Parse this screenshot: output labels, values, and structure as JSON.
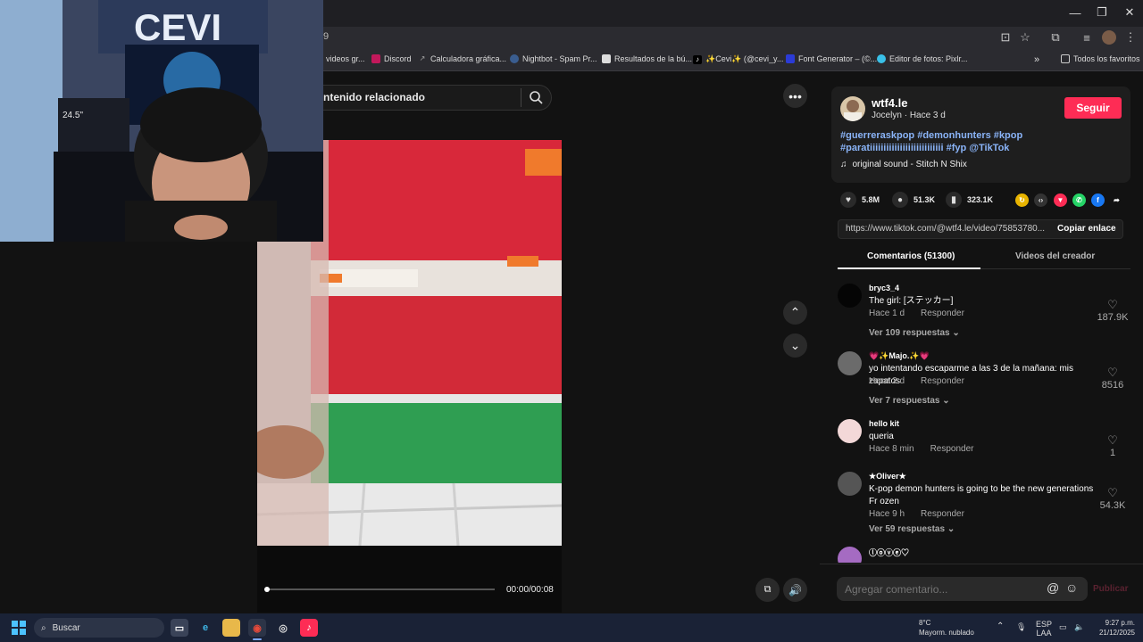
{
  "browser": {
    "address_fragment": "9",
    "bookmarks": [
      {
        "label": "videos gr..."
      },
      {
        "label": "Discord"
      },
      {
        "label": "Calculadora gráfica..."
      },
      {
        "label": "Nightbot - Spam Pr..."
      },
      {
        "label": "Resultados de la bú..."
      },
      {
        "label": "✨Cevi✨ (@cevi_y..."
      },
      {
        "label": "Font Generator – (©..."
      },
      {
        "label": "Editor de fotos: Pixlr..."
      }
    ],
    "all_favorites": "Todos los favoritos"
  },
  "webcam": {
    "banner_text": "CEVI",
    "monitor_text": "24.5\""
  },
  "search": {
    "text": "ntenido relacionado"
  },
  "video": {
    "timecode": "00:00/00:08",
    "progress": 0.0
  },
  "post": {
    "username": "wtf4.le",
    "display_name": "Jocelyn",
    "separator": "·",
    "posted": "Hace 3 d",
    "follow_label": "Seguir",
    "hashtags_line1": "#guerreraskpop #demonhunters #kpop",
    "hashtags_line2": "#paratiiiiiiiiiiiiiiiiiiiiiiiiiii #fyp @TikTok",
    "sound": "original sound - Stitch N Shix",
    "likes": "5.8M",
    "comments": "51.3K",
    "saves": "323.1K",
    "link": "https://www.tiktok.com/@wtf4.le/video/75853780...",
    "copy_label": "Copiar enlace"
  },
  "tabs": {
    "comments": "Comentarios (51300)",
    "creator_videos": "Videos del creador"
  },
  "reply_label": "Responder",
  "comments": [
    {
      "user": "bryc3_4",
      "text": "The girl: [ステッカー]",
      "time": "Hace 1 d",
      "likes": "187.9K",
      "replies": "Ver 109 respuestas"
    },
    {
      "user": "💗✨Majo.✨💗",
      "text": "yo intentando escaparme a las 3 de la mañana: mis zapatos",
      "time": "Hace 2 d",
      "likes": "8516",
      "replies": "Ver 7 respuestas"
    },
    {
      "user": "hello kit",
      "text": "queria",
      "time": "Hace 8 min",
      "likes": "1",
      "replies": ""
    },
    {
      "user": "★Oliver★",
      "text": "K-pop demon hunters is going to be the new generations Fr ozen",
      "time": "Hace 9 h",
      "likes": "54.3K",
      "replies": "Ver 59 respuestas"
    },
    {
      "user": "ⓛⓞⓥⓔ♡",
      "text": "",
      "time": "",
      "likes": "",
      "replies": ""
    }
  ],
  "comment_bar": {
    "placeholder": "Agregar comentario...",
    "publish": "Publicar"
  },
  "taskbar": {
    "search": "Buscar",
    "temp": "8°C",
    "weather": "Mayorm. nublado",
    "lang1": "ESP",
    "lang2": "LAA",
    "time": "9:27 p.m.",
    "date": "21/12/2025"
  },
  "colors": {
    "accent": "#fe2c55",
    "hashtag": "#8ab4f8",
    "background": "#121212"
  }
}
